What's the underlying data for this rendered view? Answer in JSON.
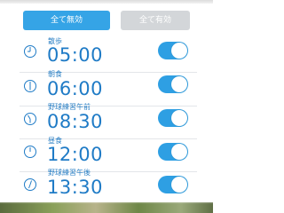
{
  "buttons": {
    "all_disable": "全て無効",
    "all_enable": "全て有効"
  },
  "alarms": [
    {
      "label": "散歩",
      "time": "05:00",
      "enabled": true,
      "icon": "clock-icon"
    },
    {
      "label": "朝食",
      "time": "06:00",
      "enabled": true,
      "icon": "clock-icon"
    },
    {
      "label": "野球練習午前",
      "time": "08:30",
      "enabled": true,
      "icon": "clock-icon"
    },
    {
      "label": "昼食",
      "time": "12:00",
      "enabled": true,
      "icon": "clock-icon"
    },
    {
      "label": "野球練習午後",
      "time": "13:30",
      "enabled": true,
      "icon": "clock-icon"
    }
  ],
  "colors": {
    "accent": "#2e9fe3",
    "text": "#1f7bc6",
    "disabled_button": "#d3d6d9"
  }
}
